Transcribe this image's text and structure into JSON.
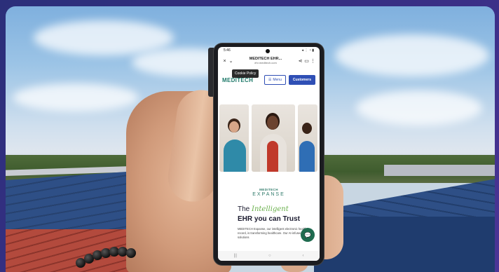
{
  "status_bar": {
    "time": "5:46",
    "icons": "◂ ⋮ ◔ ▮"
  },
  "browser": {
    "title": "MEDITECH EHR...",
    "url": "ehr.meditech.com",
    "close_icon": "×",
    "chevron_icon": "⌄",
    "share_icon": "⋖",
    "bookmark_icon": "▭",
    "more_icon": "⋮"
  },
  "tooltip": "Cookie Policy",
  "site": {
    "logo": "MEDITECH",
    "menu_label": "Menu",
    "menu_icon": "☰",
    "customers_label": "Customers",
    "brand_small": "MEDITECH",
    "brand_expanse": "EXPANSE",
    "headline_prefix": "The ",
    "headline_highlight": "Intelligent",
    "headline_line2": "EHR you can Trust",
    "body": "MEDITECH Expanse, our intelligent electronic health record, is transforming healthcare. Our AI-infused solutions",
    "chat_icon": "💬"
  },
  "nav": {
    "recent": "|||",
    "home": "○",
    "back": "‹"
  }
}
